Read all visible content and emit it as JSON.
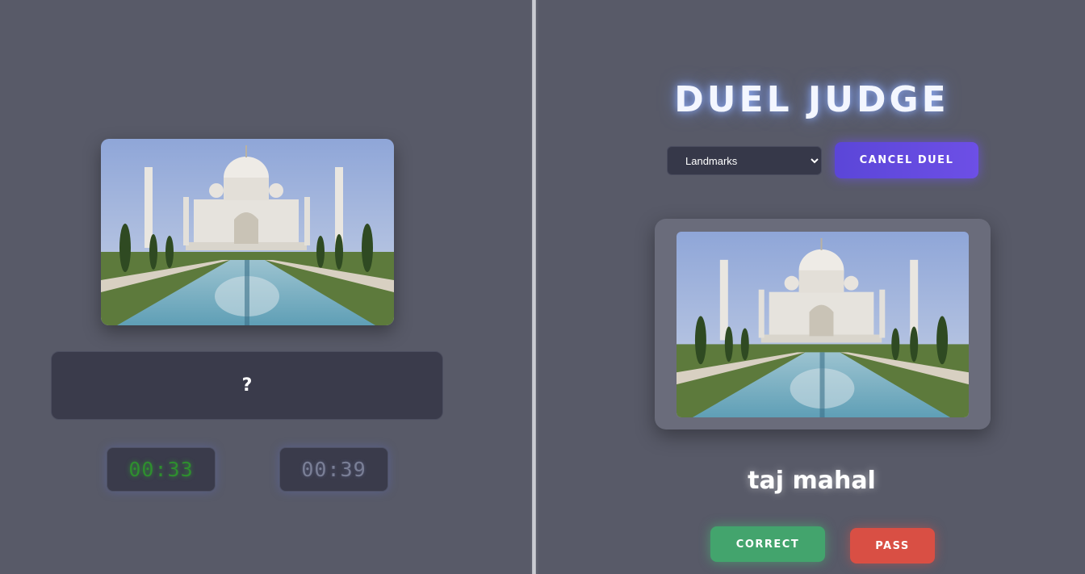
{
  "player_panel": {
    "image_alt": "Taj Mahal",
    "answer_placeholder": "?",
    "timers": [
      "00:33",
      "00:39"
    ]
  },
  "judge_panel": {
    "title": "DUEL JUDGE",
    "category": {
      "selected": "Landmarks",
      "options": [
        "Landmarks"
      ]
    },
    "cancel_label": "CANCEL DUEL",
    "image_alt": "Taj Mahal",
    "answer": "taj mahal",
    "correct_label": "CORRECT",
    "pass_label": "PASS"
  },
  "colors": {
    "background": "#585a68",
    "timer_active": "#2e8f2e",
    "timer_inactive": "#7a7f96",
    "cancel_button": "#5b46d8",
    "correct_button": "#43a46d",
    "pass_button": "#d94f44"
  },
  "icons": [
    "taj-mahal-image"
  ]
}
